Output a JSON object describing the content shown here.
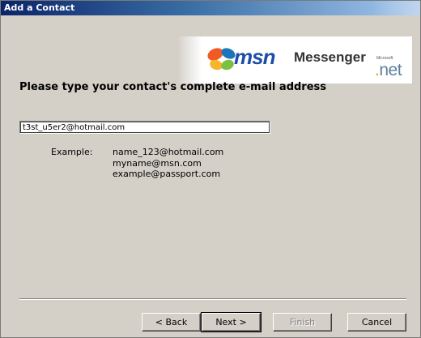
{
  "window": {
    "title": "Add a Contact"
  },
  "branding": {
    "msn": "msn",
    "messenger": "Messenger",
    "net": "net",
    "net_dot": ".",
    "microsoft": "Microsoft"
  },
  "main": {
    "heading": "Please type your contact's complete e-mail address",
    "email_value": "t3st_u5er2@hotmail.com",
    "example_label": "Example:",
    "examples": [
      "name_123@hotmail.com",
      "myname@msn.com",
      "example@passport.com"
    ]
  },
  "buttons": {
    "back": "< Back",
    "next": "Next >",
    "finish": "Finish",
    "cancel": "Cancel"
  },
  "colors": {
    "title_start": "#0a246a",
    "title_end": "#a6caf0",
    "dialog": "#d4d0c8",
    "msn_blue": "#1c4ea8"
  }
}
